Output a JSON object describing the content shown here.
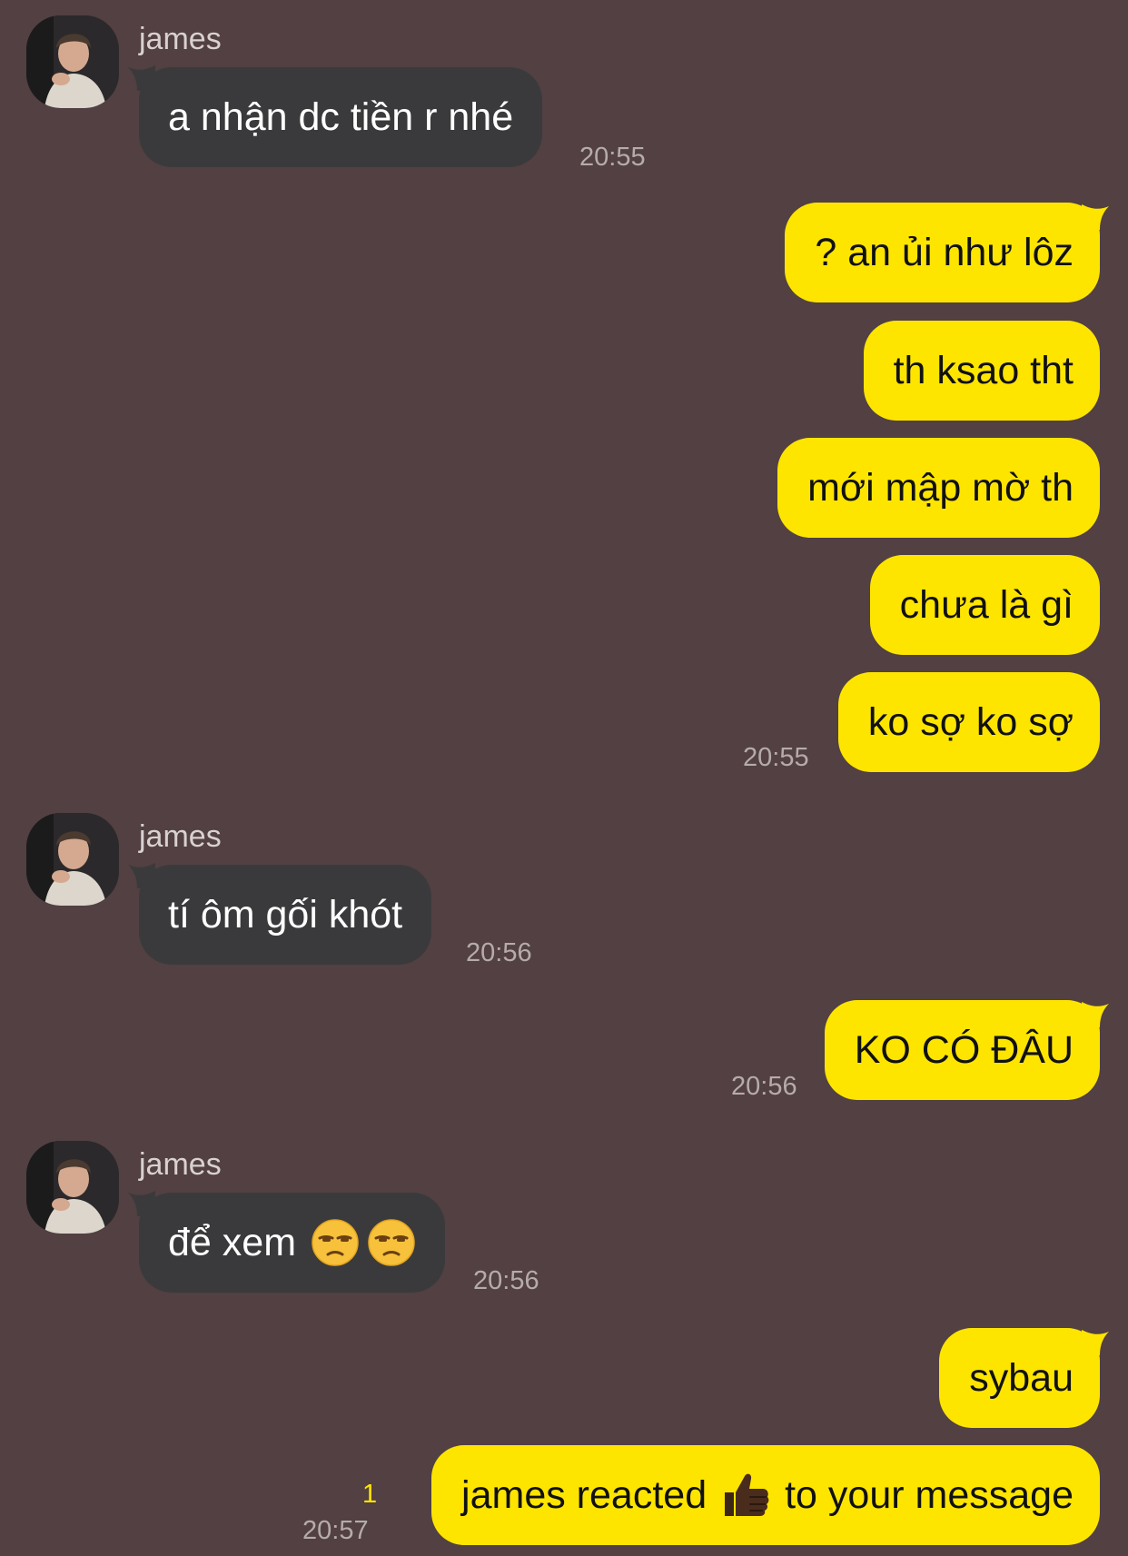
{
  "theme": {
    "background": "#524042",
    "incoming_bubble": "#3a3a3c",
    "outgoing_bubble": "#fee500",
    "timestamp_color": "#b6abab",
    "unread_color": "#fee500"
  },
  "messages": [
    {
      "sender": "james",
      "text": "a nhận dc tiền r nhé",
      "time": "20:55"
    },
    {
      "text": "? an ủi như lôz"
    },
    {
      "text": "th ksao tht"
    },
    {
      "text": "mới mập mờ th"
    },
    {
      "text": "chưa là gì"
    },
    {
      "text": "ko sợ ko sợ",
      "time": "20:55"
    },
    {
      "sender": "james",
      "text": "tí ôm gối khót",
      "time": "20:56"
    },
    {
      "text": "KO CÓ ĐÂU",
      "time": "20:56"
    },
    {
      "sender": "james",
      "text": "để xem",
      "emojis": [
        "unamused-face-icon",
        "unamused-face-icon"
      ],
      "time": "20:56"
    },
    {
      "text": "sybau"
    },
    {
      "text_before": "james reacted",
      "emoji": "thumbs-up-icon",
      "text_after": "to your message",
      "unread_count": "1",
      "time": "20:57"
    }
  ]
}
